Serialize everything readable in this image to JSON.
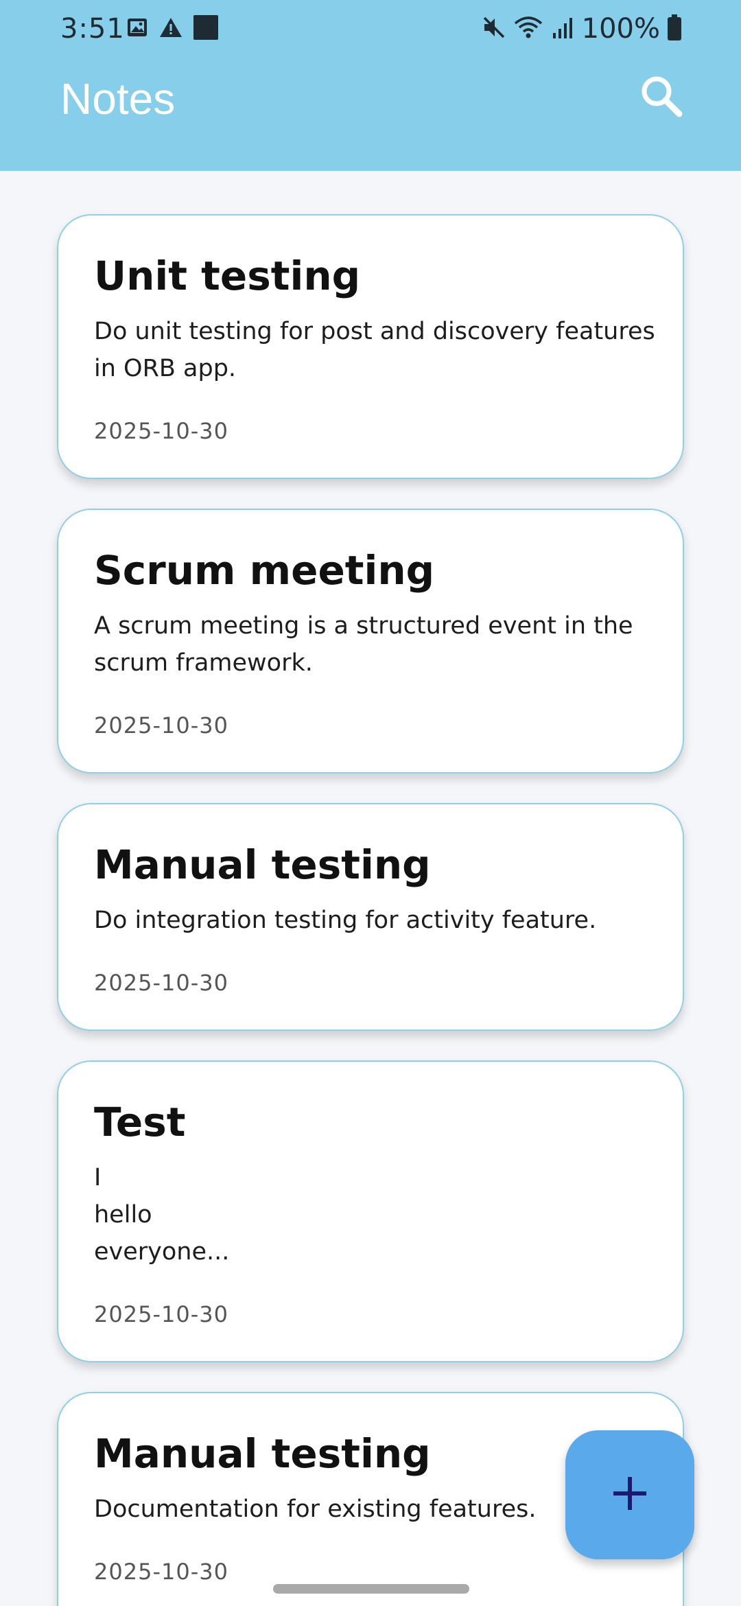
{
  "status_bar": {
    "time": "3:51",
    "left_icons": [
      "image-icon",
      "warning-icon",
      "square-icon"
    ],
    "right_icons": [
      "mute-icon",
      "wifi-icon",
      "signal-icon",
      "battery-icon"
    ],
    "battery_text": "100%"
  },
  "app_bar": {
    "title": "Notes",
    "search_icon": "search-icon",
    "background_color": "#87ceeb"
  },
  "notes": [
    {
      "title": "Unit testing",
      "body": "Do unit testing for post and discovery features\nin ORB app.",
      "date": "2025-10-30"
    },
    {
      "title": "Scrum meeting",
      "body": "A scrum meeting is a structured event in the\nscrum framework.",
      "date": "2025-10-30"
    },
    {
      "title": "Manual testing",
      "body": "Do integration testing for activity feature.",
      "date": "2025-10-30"
    },
    {
      "title": "Test",
      "body": "I\nhello\neveryone...",
      "date": "2025-10-30"
    },
    {
      "title": "Manual testing",
      "body": "Documentation for existing features.",
      "date": "2025-10-30"
    }
  ],
  "fab": {
    "icon": "plus-icon",
    "color": "#5aa9ea"
  }
}
